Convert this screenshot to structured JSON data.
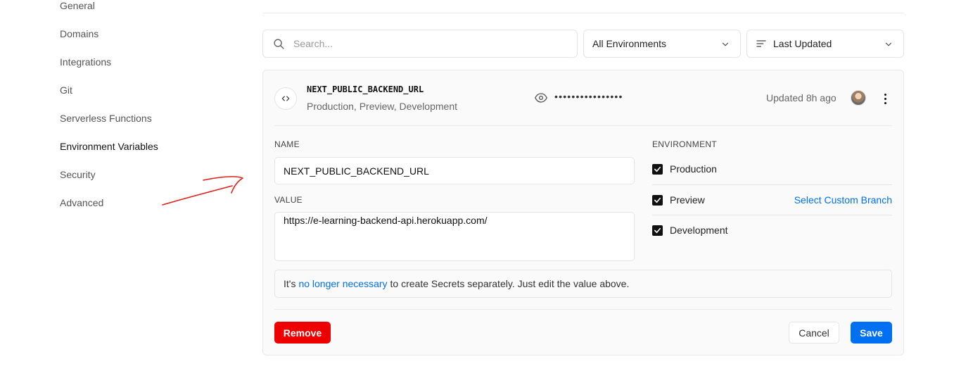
{
  "sidebar": {
    "items": [
      {
        "label": "General"
      },
      {
        "label": "Domains"
      },
      {
        "label": "Integrations"
      },
      {
        "label": "Git"
      },
      {
        "label": "Serverless Functions"
      },
      {
        "label": "Environment Variables",
        "active": true
      },
      {
        "label": "Security"
      },
      {
        "label": "Advanced"
      }
    ]
  },
  "toolbar": {
    "search_placeholder": "Search...",
    "environment_filter": "All Environments",
    "sort": "Last Updated"
  },
  "variable": {
    "name": "NEXT_PUBLIC_BACKEND_URL",
    "environments_summary": "Production, Preview, Development",
    "masked_value": "••••••••••••••••",
    "updated": "Updated 8h ago"
  },
  "editor": {
    "name_label": "NAME",
    "name_value": "NEXT_PUBLIC_BACKEND_URL",
    "value_label": "VALUE",
    "value_value": "https://e-learning-backend-api.herokuapp.com/",
    "environment_label": "ENVIRONMENT",
    "environments": [
      {
        "label": "Production",
        "checked": true
      },
      {
        "label": "Preview",
        "checked": true
      },
      {
        "label": "Development",
        "checked": true
      }
    ],
    "custom_branch_link": "Select Custom Branch",
    "notice_prefix": "It's",
    "notice_link": "no longer necessary",
    "notice_suffix": "to create Secrets separately. Just edit the value above.",
    "remove_label": "Remove",
    "cancel_label": "Cancel",
    "save_label": "Save"
  },
  "colors": {
    "accent": "#0070f3",
    "danger": "#ee0000",
    "annotation": "#e0201a"
  },
  "icons": [
    "search-icon",
    "chevron-down-icon",
    "sort-lines-icon",
    "code-brackets-icon",
    "eye-icon",
    "more-vertical-icon",
    "checkmark-icon"
  ]
}
